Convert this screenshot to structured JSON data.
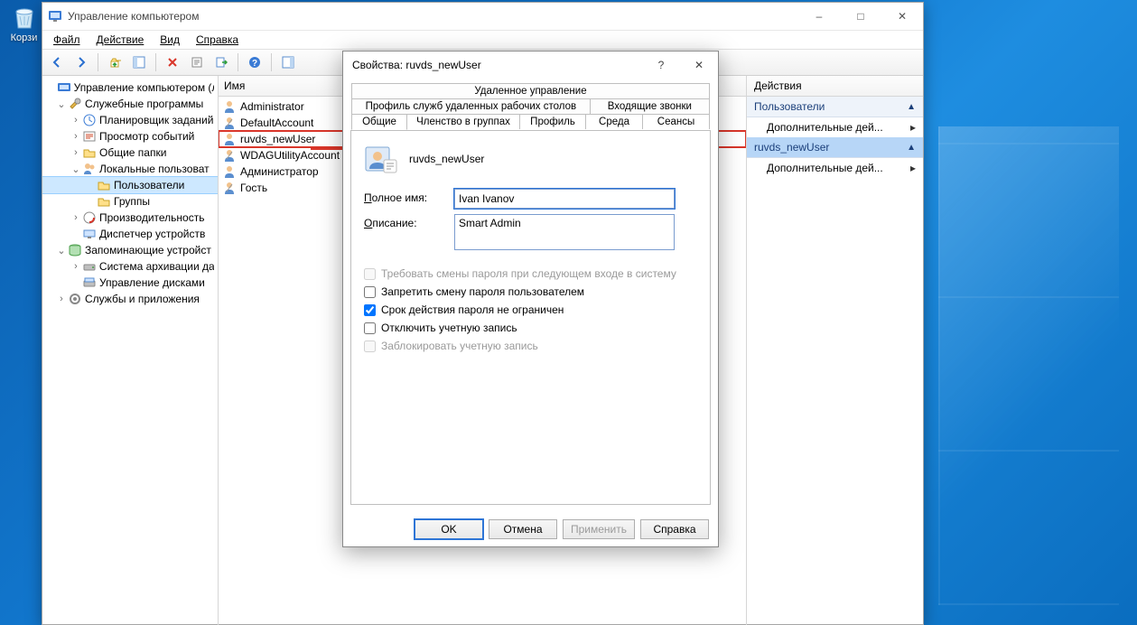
{
  "desktop": {
    "recycle_bin": "Корзи"
  },
  "window": {
    "title": "Управление компьютером",
    "menu": {
      "file": "Файл",
      "action": "Действие",
      "view": "Вид",
      "help": "Справка"
    }
  },
  "tree": {
    "root": "Управление компьютером (л",
    "utilities": "Служебные программы",
    "scheduler": "Планировщик заданий",
    "eventviewer": "Просмотр событий",
    "sharedfolders": "Общие папки",
    "localusers": "Локальные пользоват",
    "users": "Пользователи",
    "groups": "Группы",
    "perf": "Производительность",
    "devmgr": "Диспетчер устройств",
    "storage": "Запоминающие устройст",
    "backup": "Система архивации да",
    "diskmgr": "Управление дисками",
    "services": "Службы и приложения"
  },
  "list": {
    "header": "Имя",
    "items": [
      "Administrator",
      "DefaultAccount",
      "ruvds_newUser",
      "WDAGUtilityAccount",
      "Администратор",
      "Гость"
    ]
  },
  "actions": {
    "header": "Действия",
    "section1": "Пользователи",
    "item1": "Дополнительные дей...",
    "section2": "ruvds_newUser",
    "item2": "Дополнительные дей..."
  },
  "dialog": {
    "title": "Свойства: ruvds_newUser",
    "tabs": {
      "remote_mgmt": "Удаленное управление",
      "rd_profile": "Профиль служб удаленных рабочих столов",
      "incoming": "Входящие звонки",
      "general": "Общие",
      "membership": "Членство в группах",
      "profile": "Профиль",
      "env": "Среда",
      "sessions": "Сеансы"
    },
    "username": "ruvds_newUser",
    "labels": {
      "fullname": "Полное имя:",
      "description": "Описание:"
    },
    "values": {
      "fullname": "Ivan Ivanov",
      "description": "Smart Admin"
    },
    "checks": {
      "mustchange": "Требовать смены пароля при следующем входе в систему",
      "cannotchange": "Запретить смену пароля пользователем",
      "neverexpire": "Срок действия пароля не ограничен",
      "disabled": "Отключить учетную запись",
      "locked": "Заблокировать учетную запись"
    },
    "buttons": {
      "ok": "OK",
      "cancel": "Отмена",
      "apply": "Применить",
      "help": "Справка"
    }
  }
}
